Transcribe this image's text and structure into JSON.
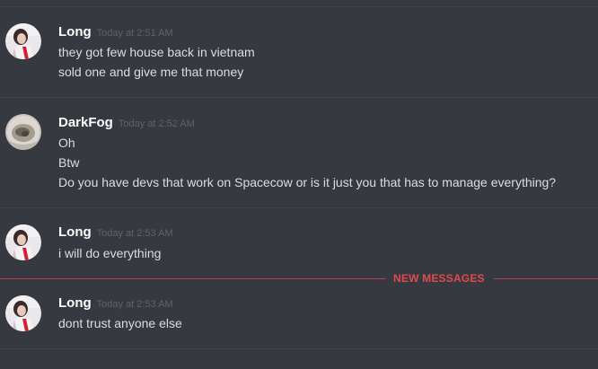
{
  "messages": [
    {
      "author": "Long",
      "avatar": "long-avatar",
      "timestamp": "Today at 2:51 AM",
      "lines": [
        "they got few house back in vietnam",
        "sold one and give me that money"
      ]
    },
    {
      "author": "DarkFog",
      "avatar": "darkfog-avatar",
      "timestamp": "Today at 2:52 AM",
      "lines": [
        "Oh",
        "Btw",
        "Do you have devs that work on Spacecow or is it just you that has to manage everything?"
      ]
    },
    {
      "author": "Long",
      "avatar": "long-avatar",
      "timestamp": "Today at 2:53 AM",
      "lines": [
        "i will do everything"
      ]
    },
    {
      "author": "Long",
      "avatar": "long-avatar",
      "timestamp": "Today at 2:53 AM",
      "lines": [
        "dont trust anyone else"
      ]
    }
  ],
  "new_messages_label": "NEW MESSAGES",
  "colors": {
    "background": "#36393f",
    "username": "#ffffff",
    "message_text": "#dcddde",
    "timestamp": "#5f6267",
    "new_messages": "#e04b4b"
  }
}
